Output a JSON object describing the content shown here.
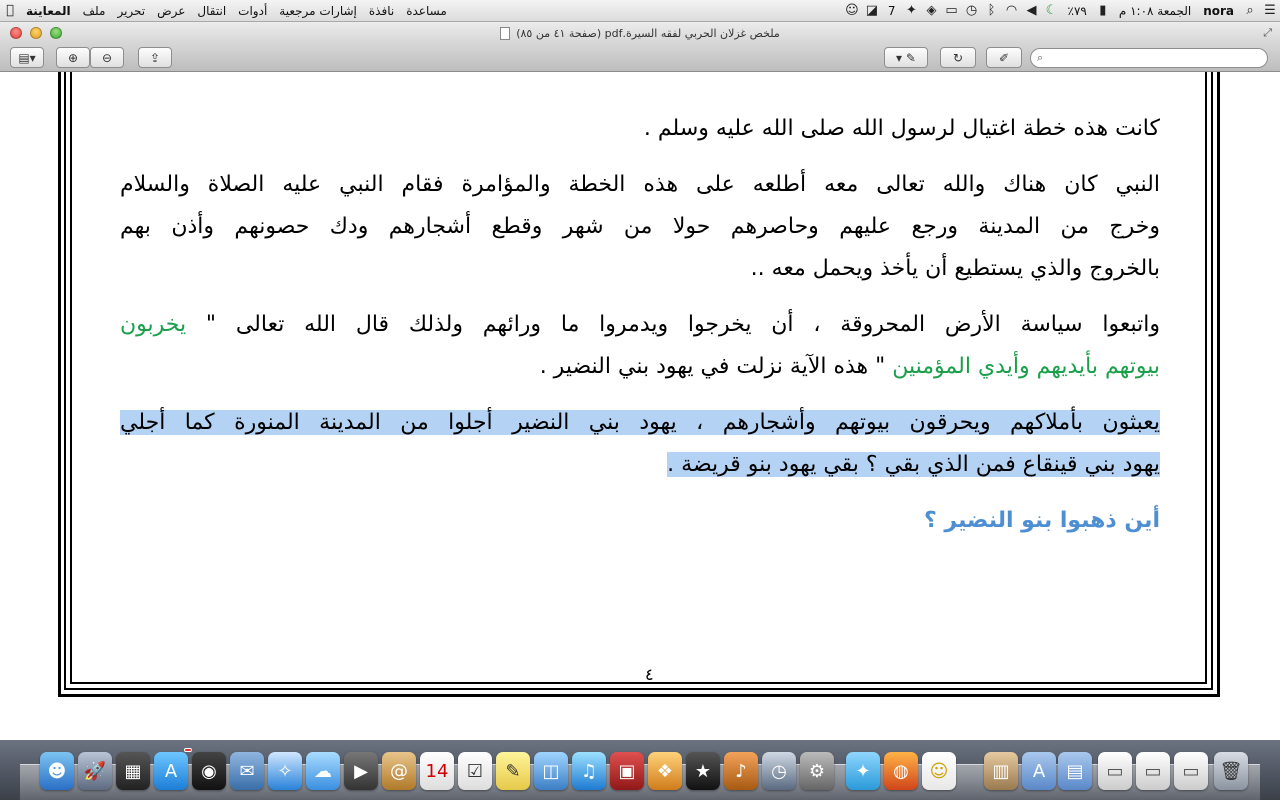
{
  "menubar": {
    "apple": "",
    "app_name": "المعاينة",
    "menus": [
      "ملف",
      "تحرير",
      "عرض",
      "انتقال",
      "أدوات",
      "إشارات مرجعية",
      "نافذة",
      "مساعدة"
    ],
    "status": {
      "badge_count": "7",
      "battery": "٧٩٪",
      "clock": "الجمعة ١:٠٨ م",
      "user": "nora"
    }
  },
  "window": {
    "title": "ملخص غزلان الحربي لفقه السيرة.pdf (صفحة ٤١ من ٨٥)"
  },
  "toolbar": {
    "search_placeholder": ""
  },
  "document": {
    "lines": {
      "l1": "كانت هذه خطة اغتيال لرسول الله صلى الله عليه وسلم .",
      "l2": "النبي كان هناك والله تعالى معه أطلعه على هذه الخطة والمؤامرة فقام النبي عليه الصلاة والسلام",
      "l3": "وخرج من المدينة ورجع عليهم وحاصرهم حولا من شهر وقطع أشجارهم ودك حصونهم وأذن بهم",
      "l4": "بالخروج والذي يستطيع أن يأخذ ويحمل معه ..",
      "l5a": "واتبعوا سياسة الأرض المحروقة ، أن يخرجوا ويدمروا ما ورائهم ولذلك قال الله تعالى \" ",
      "l5b": "يخربون",
      "l6a": "بيوتهم بأيديهم وأيدي المؤمنين",
      "l6b": " \" هذه الآية نزلت في يهود بني النضير .",
      "l7": "يعبثون بأملاكهم ويحرقون بيوتهم وأشجارهم ، يهود بني النضير أجلوا من المدينة المنورة كما أجلي",
      "l8": "يهود بني قينقاع فمن الذي بقي ؟ بقي يهود بنو قريضة .",
      "heading": "أين ذهبوا بنو النضير ؟"
    },
    "page_number": "٤"
  },
  "colors": {
    "highlight": "#b4d2f3",
    "quran_green": "#1aa04a",
    "heading_blue": "#4e8fd4"
  }
}
